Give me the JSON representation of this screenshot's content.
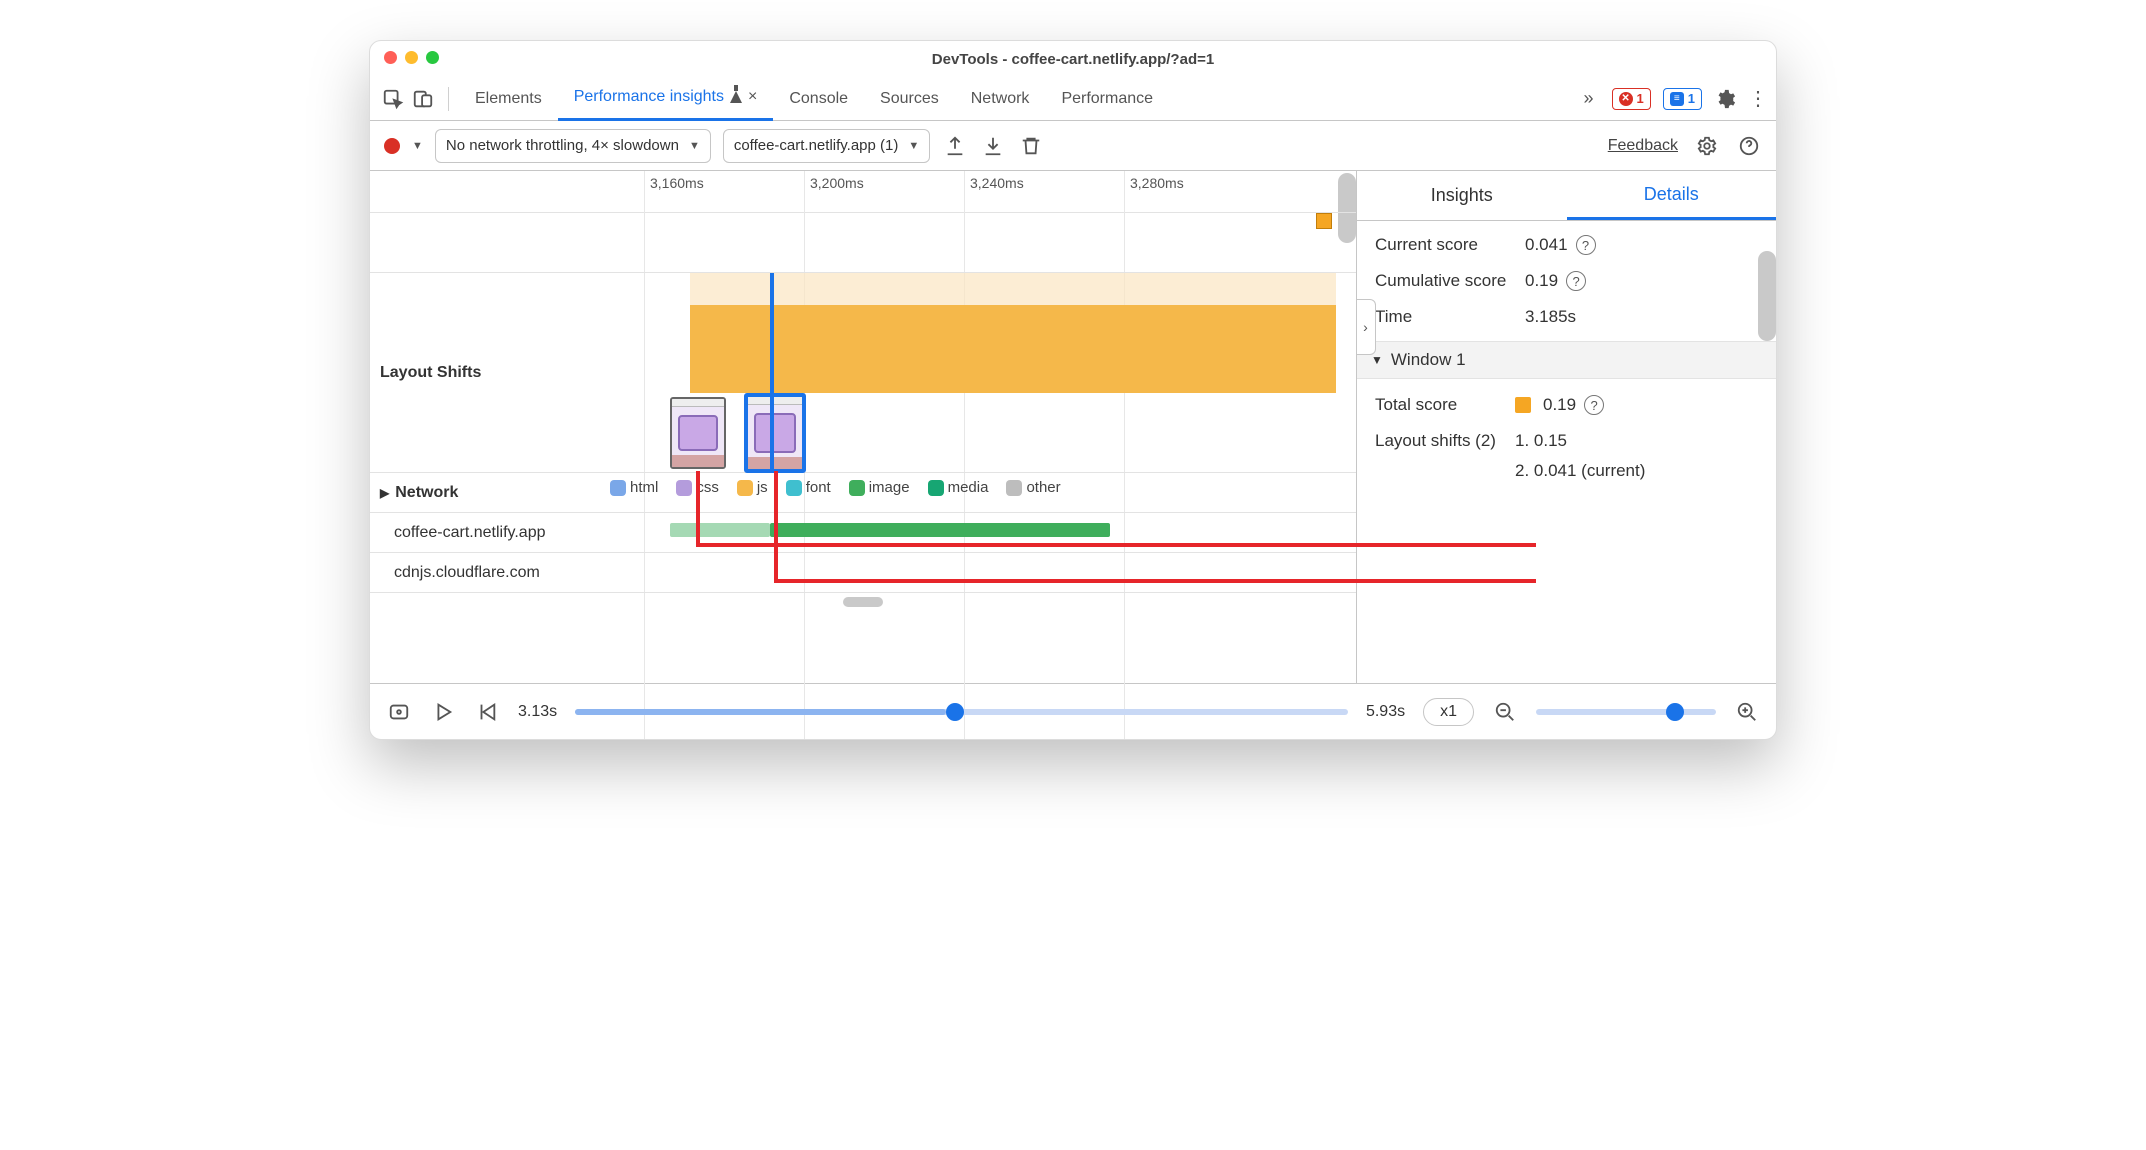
{
  "window": {
    "title": "DevTools - coffee-cart.netlify.app/?ad=1"
  },
  "tabs": {
    "items": [
      "Elements",
      "Performance insights",
      "Console",
      "Sources",
      "Network",
      "Performance"
    ],
    "active_index": 1,
    "error_count": "1",
    "issue_count": "1"
  },
  "subbar": {
    "throttling": "No network throttling, 4× slowdown",
    "recording": "coffee-cart.netlify.app (1)",
    "feedback": "Feedback"
  },
  "timeline": {
    "ticks": [
      "3,160ms",
      "3,200ms",
      "3,240ms",
      "3,280ms"
    ],
    "layout_shifts_label": "Layout Shifts",
    "network_label": "Network",
    "network_legend": [
      {
        "name": "html",
        "color": "#7aa7e8"
      },
      {
        "name": "css",
        "color": "#b49cdc"
      },
      {
        "name": "js",
        "color": "#f5b84a"
      },
      {
        "name": "font",
        "color": "#3fbfcf"
      },
      {
        "name": "image",
        "color": "#3fae5c"
      },
      {
        "name": "media",
        "color": "#17a673"
      },
      {
        "name": "other",
        "color": "#bdbdbd"
      }
    ],
    "network_rows": [
      {
        "host": "coffee-cart.netlify.app"
      },
      {
        "host": "cdnjs.cloudflare.com"
      }
    ]
  },
  "right": {
    "tabs": [
      "Insights",
      "Details"
    ],
    "active_index": 1,
    "current_score_label": "Current score",
    "current_score_value": "0.041",
    "cumulative_score_label": "Cumulative score",
    "cumulative_score_value": "0.19",
    "time_label": "Time",
    "time_value": "3.185s",
    "window_header": "Window 1",
    "total_score_label": "Total score",
    "total_score_value": "0.19",
    "layout_shifts_label": "Layout shifts (2)",
    "shift1": "1. 0.15",
    "shift2": "2. 0.041 (current)"
  },
  "footer": {
    "start": "3.13s",
    "end": "5.93s",
    "speed": "x1"
  }
}
